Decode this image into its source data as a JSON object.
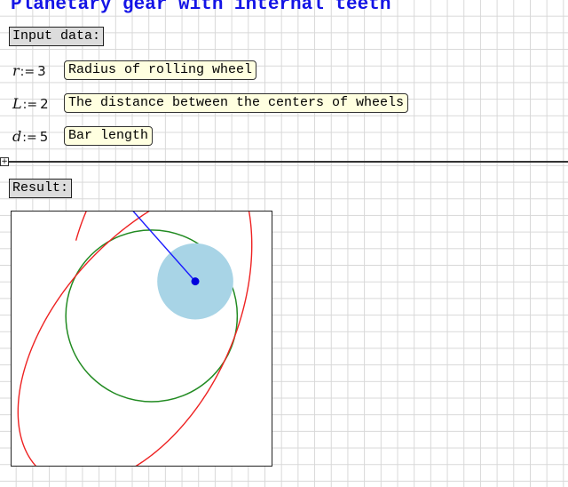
{
  "worksheet": {
    "title": "Planetary gear with internal teeth",
    "input_label": "Input data:",
    "result_label": "Result:",
    "region_toggle": "+"
  },
  "definitions": [
    {
      "var": "r",
      "op": ":=",
      "value": "3",
      "comment": "Radius of rolling wheel"
    },
    {
      "var": "L",
      "op": ":=",
      "value": "2",
      "comment": "The distance between the centers of wheels"
    },
    {
      "var": "d",
      "op": ":=",
      "value": "5",
      "comment": "Bar length"
    }
  ],
  "plot": {
    "params": {
      "R": 3,
      "r": 1.33,
      "L": 2,
      "d": 5
    },
    "view": {
      "x_range": [
        -4.9,
        4.2
      ],
      "y_range": [
        -5.6,
        3.9
      ]
    },
    "colors": {
      "curve": "#ee2222",
      "fixed_wheel": "#228b22",
      "rolling_wheel_fill": "#a8d4e6",
      "bar": "#1a1aff",
      "hub": "#0000dd",
      "pen": "#ee2222"
    },
    "curve_t_range": [
      0.35,
      7.1
    ],
    "snapshot_t": 0.7
  }
}
